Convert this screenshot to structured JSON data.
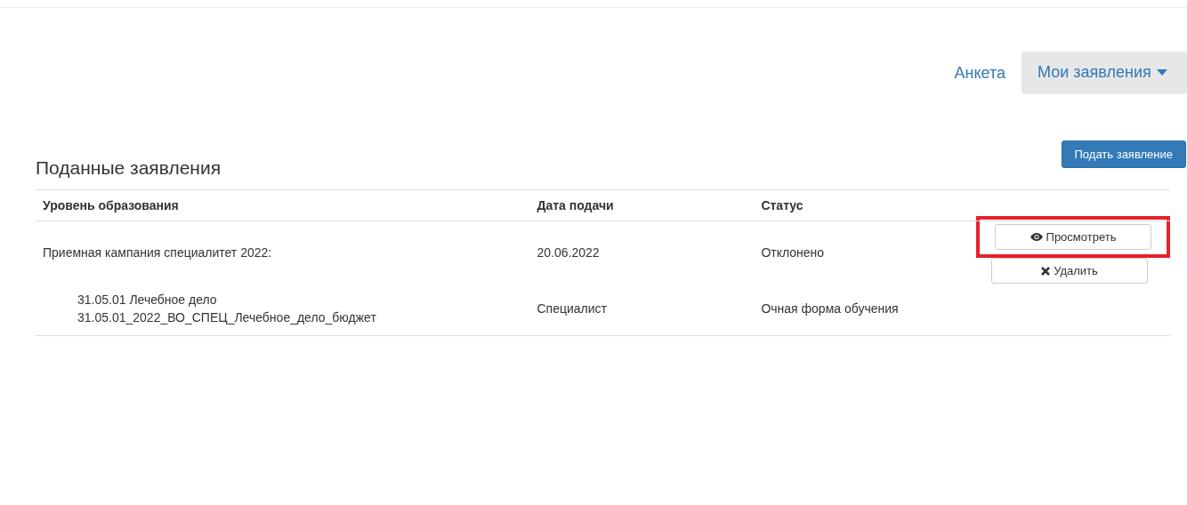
{
  "nav": [
    {
      "label": "Анкета",
      "kind": "link"
    },
    {
      "label": "Мои заявления",
      "kind": "dropdown"
    }
  ],
  "title": "Поданные заявления",
  "submit_button": "Подать заявление",
  "table": {
    "columns": [
      "Уровень образования",
      "Дата подачи",
      "Статус"
    ],
    "rows": [
      {
        "campaign": "Приемная кампания специалитет 2022:",
        "date": "20.06.2022",
        "status": "Отклонено",
        "actions": [
          {
            "label": "Просмотреть",
            "kind": "view",
            "highlighted": true
          },
          {
            "label": "Удалить",
            "kind": "delete",
            "highlighted": false
          }
        ],
        "program": {
          "lines": [
            "31.05.01 Лечебное дело",
            "31.05.01_2022_ВО_СПЕЦ_Лечебное_дело_бюджет"
          ],
          "level": "Специалист",
          "form": "Очная форма обучения"
        }
      }
    ]
  }
}
